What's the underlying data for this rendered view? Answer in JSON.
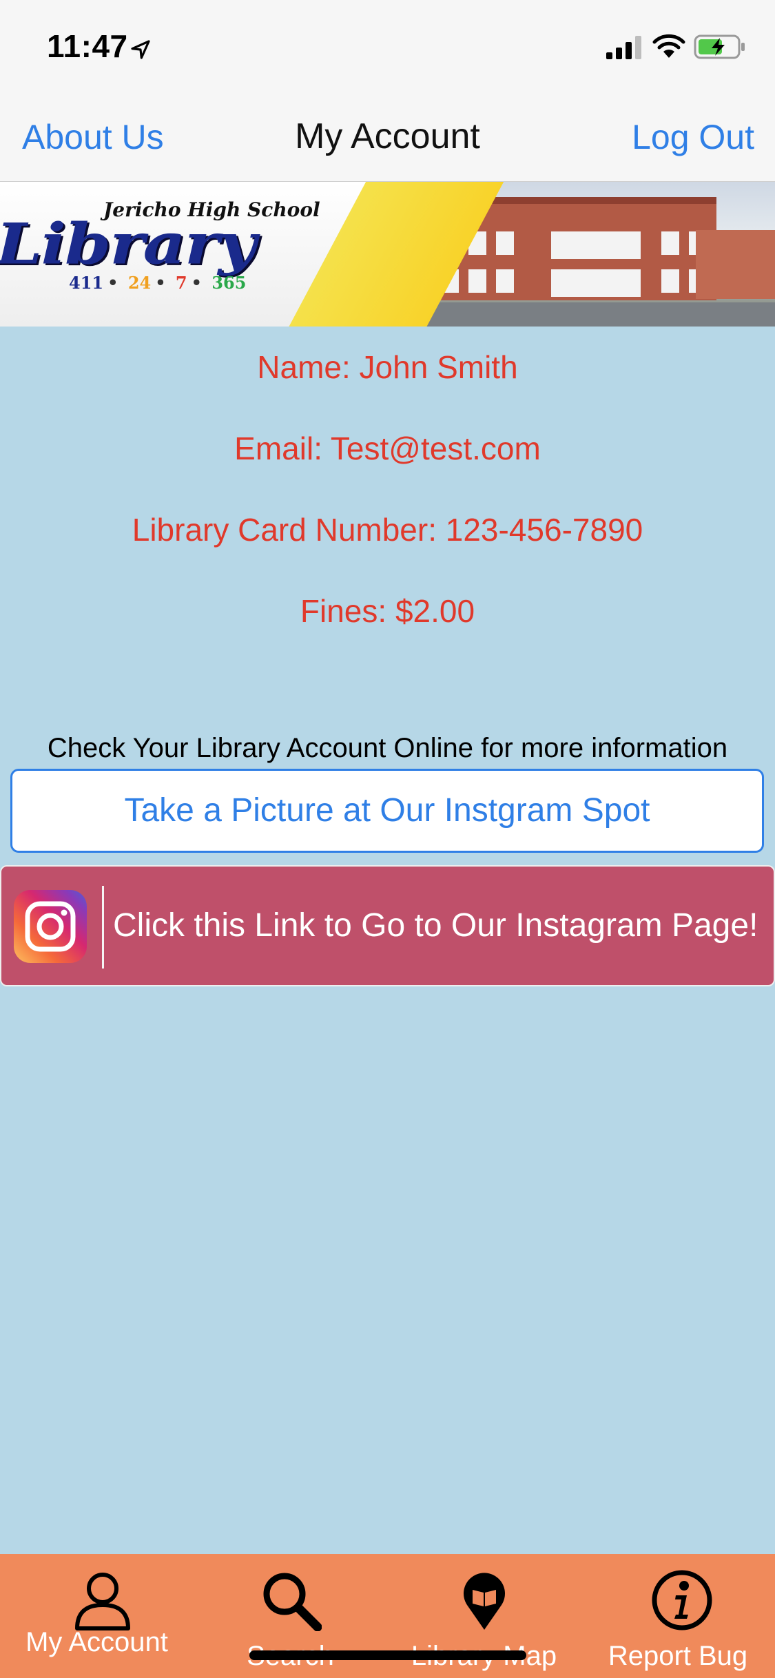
{
  "status_bar": {
    "time": "11:47",
    "icons": [
      "location-arrow-icon",
      "cellular-signal-icon",
      "wifi-icon",
      "battery-charging-icon"
    ]
  },
  "nav": {
    "left_label": "About Us",
    "title": "My Account",
    "right_label": "Log Out",
    "accent_color": "#2f7fe6"
  },
  "banner": {
    "school_name": "Jericho High School",
    "library_word": "Library",
    "tagline": [
      "411",
      "24",
      "7",
      "365"
    ],
    "tagline_colors": [
      "#1a2a8c",
      "#f0a020",
      "#e0392b",
      "#2aa84a"
    ]
  },
  "account": {
    "name": "Name: John Smith",
    "email": "Email: Test@test.com",
    "card": "Library Card Number: 123-456-7890",
    "fines": "Fines: $2.00",
    "text_color": "#e0392b"
  },
  "online_note": "Check Your Library Account Online for more information",
  "instagram_spot_button": "Take a Picture at Our Instgram Spot",
  "instagram_link": {
    "icon": "instagram-icon",
    "label": "Click this Link to Go to Our Instagram Page!",
    "background": "#bf506a"
  },
  "tabbar": {
    "background": "#f08a5b",
    "tabs": [
      {
        "label": "My Account",
        "icon": "person-icon"
      },
      {
        "label": "Search",
        "icon": "magnifier-icon"
      },
      {
        "label": "Library Map",
        "icon": "map-pin-book-icon"
      },
      {
        "label": "Report Bug",
        "icon": "info-icon"
      }
    ]
  }
}
